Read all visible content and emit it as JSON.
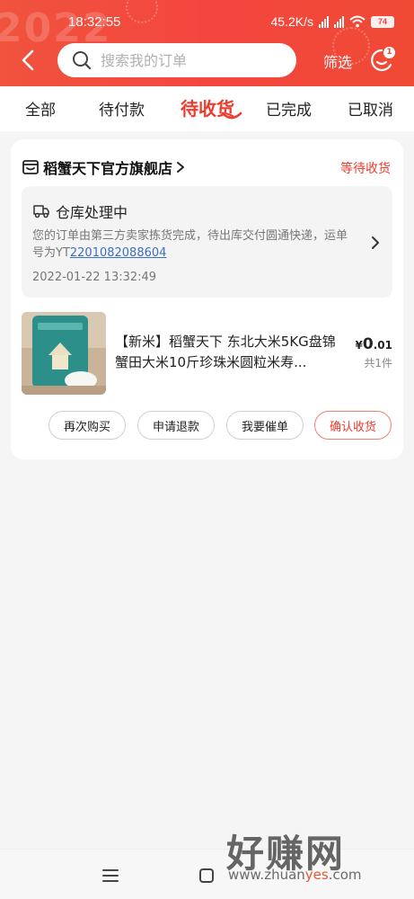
{
  "status_bar": {
    "time": "18:32:55",
    "net_speed": "45.2K/s",
    "battery": "74"
  },
  "header": {
    "decoration_text": "2022",
    "search_placeholder": "搜索我的订单",
    "filter_label": "筛选",
    "message_badge": "1",
    "accent_color": "#f04a35"
  },
  "tabs": [
    {
      "label": "全部",
      "active": false
    },
    {
      "label": "待付款",
      "active": false
    },
    {
      "label": "待收货",
      "active": true
    },
    {
      "label": "已完成",
      "active": false
    },
    {
      "label": "已取消",
      "active": false
    }
  ],
  "order": {
    "shop_name": "稻蟹天下官方旗舰店",
    "status": "等待收货",
    "logistics": {
      "title": "仓库处理中",
      "desc_prefix": "您的订单由第三方卖家拣货完成，待出库交付圆通快递，运单号为YT",
      "tracking_number": "2201082088604",
      "time": "2022-01-22 13:32:49"
    },
    "product": {
      "title": "【新米】稻蟹天下 东北大米5KG盘锦蟹田大米10斤珍珠米圆粒米寿...",
      "price_symbol": "¥",
      "price_int": "0",
      "price_dec": ".01",
      "quantity": "共1件"
    },
    "actions": {
      "rebuy": "再次购买",
      "refund": "申请退款",
      "urge": "我要催单",
      "confirm": "确认收货"
    }
  },
  "watermark": {
    "text": "好赚网",
    "url_prefix": "www.zhuan",
    "url_mid": "yes",
    "url_suffix": ".com"
  }
}
